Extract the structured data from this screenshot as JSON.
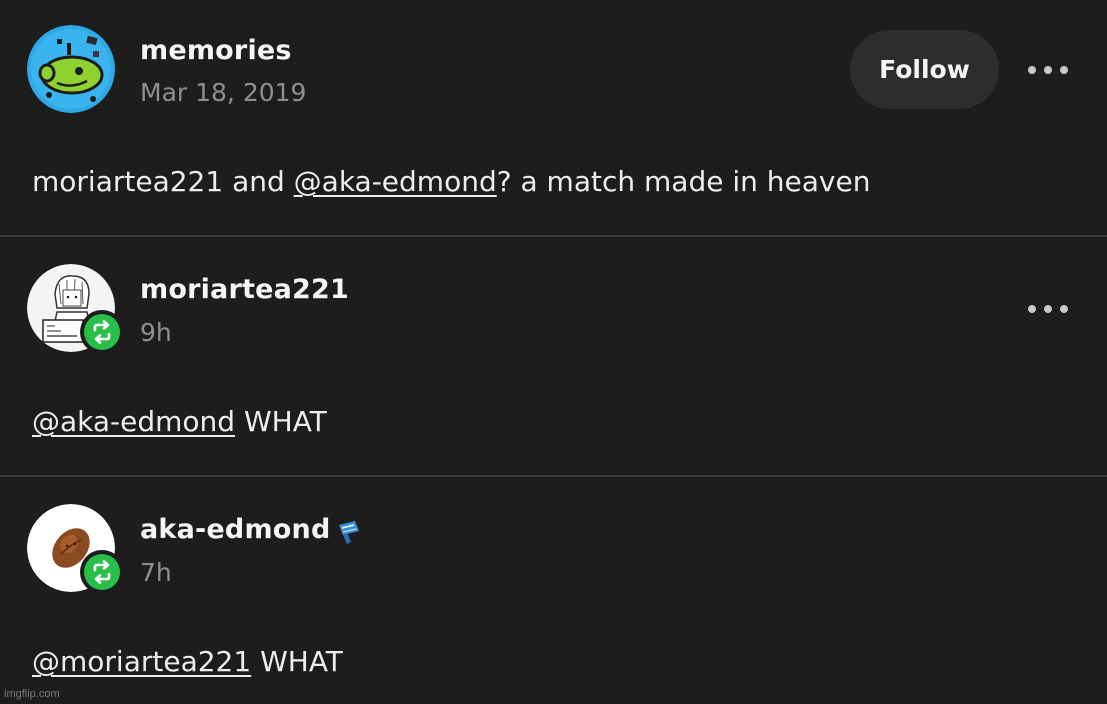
{
  "posts": [
    {
      "username": "memories",
      "timestamp": "Mar 18, 2019",
      "follow_label": "Follow",
      "body": {
        "before": "moriartea221 and ",
        "mention": "@aka-edmond",
        "after": "? a match made in heaven"
      },
      "avatar": "frog-blob-avatar"
    },
    {
      "username": "moriartea221",
      "timestamp": "9h",
      "avatar": "sketch-person-avatar",
      "body": {
        "mention": "@aka-edmond",
        "after": " WHAT"
      }
    },
    {
      "username": "aka-edmond",
      "timestamp": "7h",
      "avatar": "pecan-avatar",
      "body": {
        "mention": "@moriartea221",
        "after": " WHAT"
      }
    }
  ],
  "watermark": "imgflip.com",
  "colors": {
    "background": "#1d1d1d",
    "reblog_green": "#28c04a",
    "follow_button": "#2d2d2d",
    "divider": "#3a3a3a"
  }
}
